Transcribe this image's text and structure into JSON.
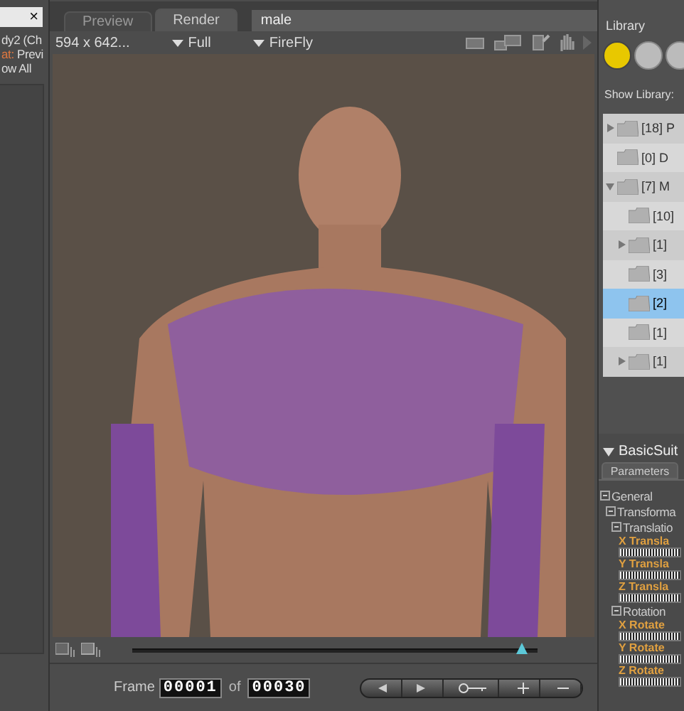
{
  "left_panel": {
    "close": "×",
    "lines": [
      {
        "kind": "plain",
        "text": "dy2 (Ch"
      },
      {
        "kind": "pair",
        "label": "at:",
        "text": "Previ"
      },
      {
        "kind": "plain",
        "text": "ow All"
      }
    ]
  },
  "viewport": {
    "tabs": [
      {
        "label": "Preview",
        "selected": false
      },
      {
        "label": "Render",
        "selected": true
      }
    ],
    "title": "male",
    "size": "594 x 642...",
    "menus": [
      "Full",
      "FireFly"
    ]
  },
  "timeline": {
    "level": 0.96
  },
  "frame": {
    "label": "Frame",
    "value": "00001",
    "of": "of",
    "total": "00030"
  },
  "library": {
    "title": "Library",
    "categories": [
      {
        "selected": true
      },
      {
        "selected": false
      },
      {
        "selected": false
      }
    ],
    "show_label": "Show Library:",
    "items": [
      {
        "label": "[18] P",
        "expanded": false,
        "selected": false
      },
      {
        "label": "[0] D",
        "selected": false
      },
      {
        "label": "[7] M",
        "expanded": true,
        "selected": false,
        "children": [
          {
            "label": "[10]",
            "selected": false
          },
          {
            "label": "[1]",
            "expanded": false,
            "selected": false
          },
          {
            "label": "[3]",
            "selected": false
          },
          {
            "label": "[2]",
            "selected": true
          },
          {
            "label": "[1]",
            "selected": false
          },
          {
            "label": "[1]",
            "expanded": false,
            "selected": false
          }
        ]
      }
    ]
  },
  "parameters": {
    "figure": "BasicSuit",
    "expanded": true,
    "tab": "Parameters",
    "tree": [
      {
        "kind": "group",
        "label": "General",
        "children": [
          {
            "kind": "group",
            "label": "Transforma",
            "children": [
              {
                "kind": "group",
                "label": "Translatio",
                "children": [
                  {
                    "kind": "dial",
                    "label": "X Transla"
                  },
                  {
                    "kind": "dial",
                    "label": "Y Transla"
                  },
                  {
                    "kind": "dial",
                    "label": "Z Transla"
                  }
                ]
              },
              {
                "kind": "group",
                "label": "Rotation",
                "children": [
                  {
                    "kind": "dial",
                    "label": "X Rotate"
                  },
                  {
                    "kind": "dial",
                    "label": "Y Rotate"
                  },
                  {
                    "kind": "dial",
                    "label": "Z Rotate"
                  }
                ]
              }
            ]
          }
        ]
      }
    ]
  }
}
